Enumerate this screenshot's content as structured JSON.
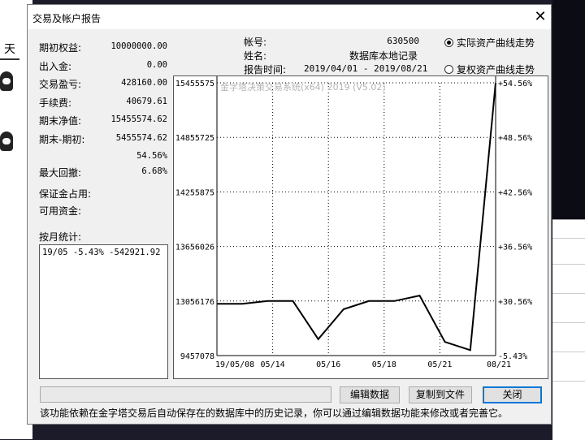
{
  "window": {
    "title": "交易及帐户报告",
    "close_glyph": "✕"
  },
  "background": {
    "left_tab": "天"
  },
  "stats": [
    {
      "label": "期初权益:",
      "value": "10000000.00"
    },
    {
      "label": "出入金:",
      "value": "0.00"
    },
    {
      "label": "交易盈亏:",
      "value": "428160.00"
    },
    {
      "label": "手续费:",
      "value": "40679.61"
    },
    {
      "label": "期末净值:",
      "value": "15455574.62"
    },
    {
      "label": "期末-期初:",
      "value": "5455574.62"
    },
    {
      "label": "",
      "value": "54.56%"
    },
    {
      "label": "最大回撤:",
      "value": "6.68%"
    },
    {
      "label": "保证金占用:",
      "value": ""
    },
    {
      "label": "可用资金:",
      "value": ""
    }
  ],
  "monthly": {
    "label": "按月统计:",
    "rows": [
      "19/05   -5.43% -542921.92"
    ]
  },
  "account": {
    "acct_label": "帐号:",
    "acct_value": "630500",
    "name_label": "姓名:",
    "name_value": "数据库本地记录",
    "time_label": "报告时间:",
    "time_value": "2019/04/01 - 2019/08/21"
  },
  "radios": [
    {
      "label": "实际资产曲线走势",
      "checked": true
    },
    {
      "label": "复权资产曲线走势",
      "checked": false
    }
  ],
  "buttons": {
    "edit": "编辑数据",
    "copy": "复制到文件",
    "close": "关闭"
  },
  "footnote": "该功能依赖在金字塔交易后自动保存在的数据库中的历史记录，你可以通过编辑数据功能来修改或者完善它。",
  "chart_data": {
    "type": "line",
    "title": "金字塔决策交易系统(x64) 2019 (V5.02)",
    "y_left_ticks": [
      "15455575",
      "14855725",
      "14255875",
      "13656026",
      "13056176",
      "9457078"
    ],
    "y_right_ticks": [
      "+54.56%",
      "+48.56%",
      "+42.56%",
      "+36.56%",
      "+30.56%",
      "-5.43%"
    ],
    "x_ticks": [
      "19/05/08",
      "05/14",
      "05/16",
      "05/18",
      "05/21",
      "08/21"
    ],
    "grid": true,
    "series": [
      {
        "values": [
          0.81,
          0.81,
          0.8,
          0.8,
          0.94,
          0.83,
          0.8,
          0.8,
          0.78,
          0.95,
          0.98,
          0.0
        ]
      }
    ],
    "colors": {
      "line": "#000000",
      "grid": "#000000",
      "title": "#b4b4b4"
    }
  }
}
